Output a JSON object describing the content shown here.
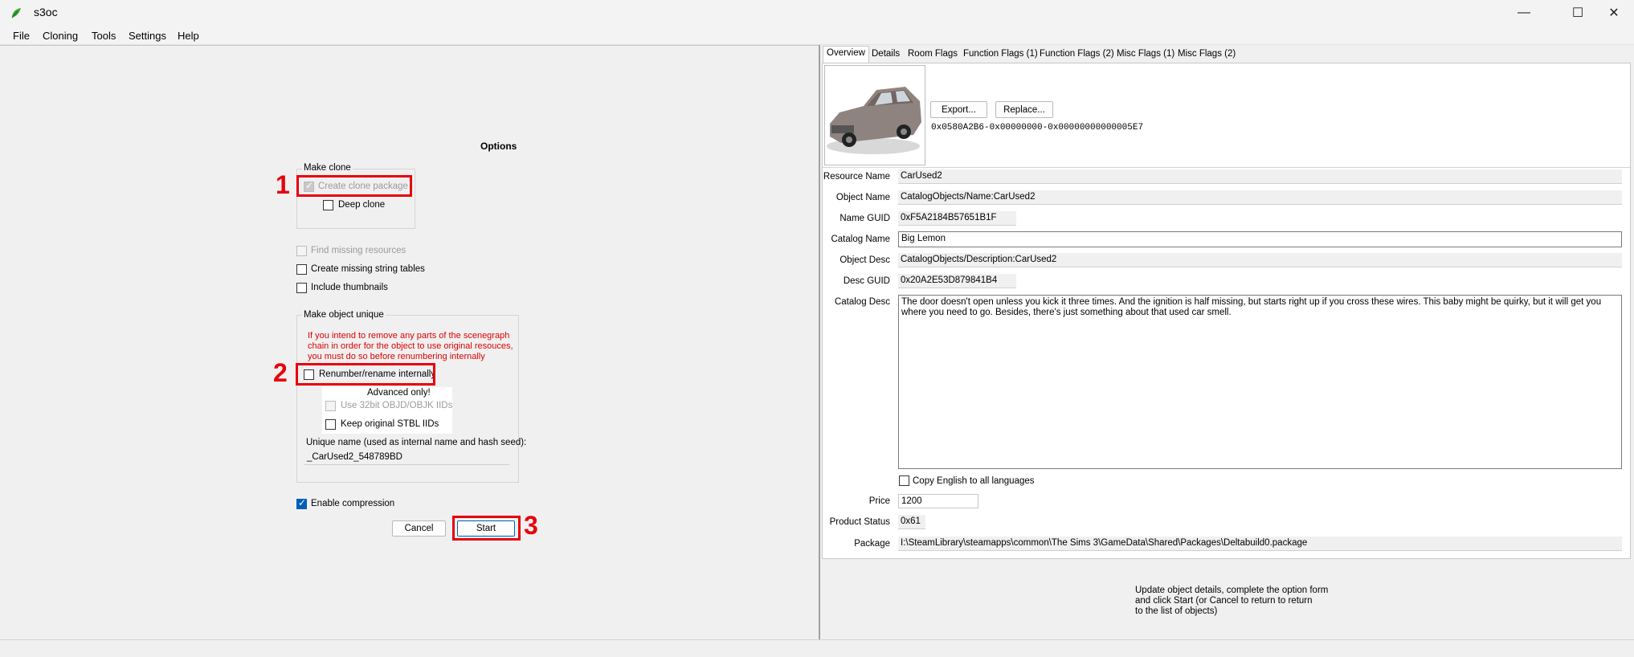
{
  "window": {
    "title": "s3oc"
  },
  "menu": [
    "File",
    "Cloning",
    "Tools",
    "Settings",
    "Help"
  ],
  "options": {
    "heading": "Options",
    "make_clone_group": "Make clone",
    "create_clone_package": "Create clone package",
    "deep_clone": "Deep clone",
    "find_missing_resources": "Find missing resources",
    "create_missing_string_tables": "Create missing string tables",
    "include_thumbnails": "Include thumbnails",
    "make_unique_group": "Make object unique",
    "warning_lines": [
      "If you intend to remove any parts of the scenegraph",
      "chain in order for the object to use original resouces,",
      "you must do so before renumbering internally"
    ],
    "renumber": "Renumber/rename internally",
    "advanced_only": "Advanced only!",
    "use_32bit": "Use 32bit OBJD/OBJK IIDs",
    "keep_stbl": "Keep original STBL IIDs",
    "unique_name_label": "Unique name (used as internal name and hash seed):",
    "unique_name_value": "_CarUsed2_548789BD",
    "enable_compression": "Enable compression",
    "cancel": "Cancel",
    "start": "Start"
  },
  "annotations": [
    "1",
    "2",
    "3"
  ],
  "tabs": [
    "Overview",
    "Details",
    "Room Flags",
    "Function Flags (1)",
    "Function Flags (2)",
    "Misc Flags (1)",
    "Misc Flags (2)"
  ],
  "overview": {
    "export": "Export...",
    "replace": "Replace...",
    "resource_key": "0x0580A2B6-0x00000000-0x00000000000005E7",
    "fields": {
      "resource_name_label": "Resource Name",
      "resource_name": "CarUsed2",
      "object_name_label": "Object Name",
      "object_name": "CatalogObjects/Name:CarUsed2",
      "name_guid_label": "Name GUID",
      "name_guid": "0xF5A2184B57651B1F",
      "catalog_name_label": "Catalog Name",
      "catalog_name": "Big Lemon",
      "object_desc_label": "Object Desc",
      "object_desc": "CatalogObjects/Description:CarUsed2",
      "desc_guid_label": "Desc GUID",
      "desc_guid": "0x20A2E53D879841B4",
      "catalog_desc_label": "Catalog Desc",
      "catalog_desc": "The door doesn't open unless you kick it three times. And the ignition is half missing, but starts right up if you cross these wires. This baby might be quirky, but it will get you where you need to go. Besides, there's just something about that used car smell.",
      "copy_english": "Copy English to all languages",
      "price_label": "Price",
      "price": "1200",
      "product_status_label": "Product Status",
      "product_status": "0x61",
      "package_label": "Package",
      "package": "I:\\SteamLibrary\\steamapps\\common\\The Sims 3\\GameData\\Shared\\Packages\\Deltabuild0.package"
    }
  },
  "help_text": [
    "Update object details, complete the option form",
    "and click Start (or Cancel to return to return",
    "to the list of objects)"
  ]
}
